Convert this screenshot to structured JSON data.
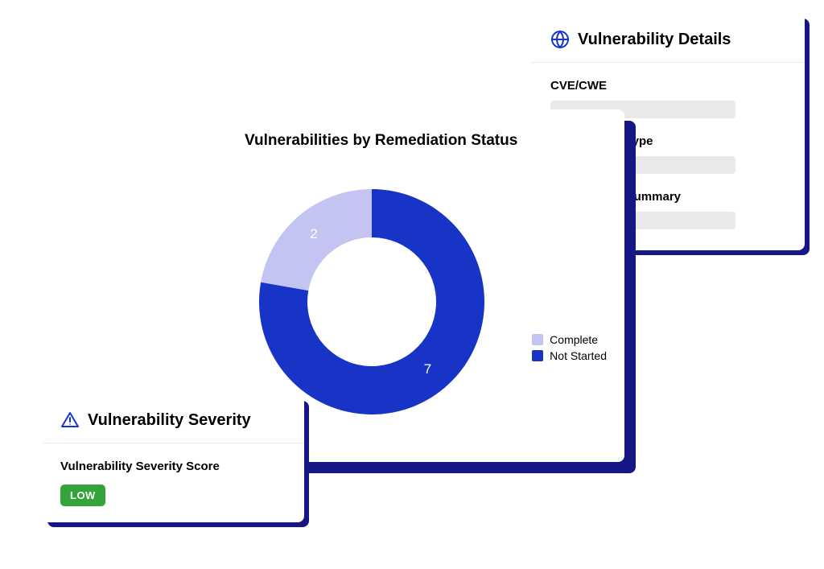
{
  "colors": {
    "primary": "#1834c7",
    "secondary": "#c4c4f2",
    "shadow": "#171686",
    "success": "#33a33a"
  },
  "details": {
    "title": "Vulnerability Details",
    "icon": "globe-icon",
    "fields": [
      {
        "label": "CVE/CWE"
      },
      {
        "label": "Vulnerability Type"
      },
      {
        "label": "Vulnerability Summary"
      }
    ]
  },
  "chart": {
    "title": "Vulnerabilities by Remediation Status",
    "legend": [
      {
        "label": "Complete",
        "color": "#c4c4f2"
      },
      {
        "label": "Not Started",
        "color": "#1834c7"
      }
    ]
  },
  "chart_data": {
    "type": "pie",
    "title": "Vulnerabilities by Remediation Status",
    "categories": [
      "Complete",
      "Not Started"
    ],
    "values": [
      2,
      7
    ],
    "series_colors": [
      "#c4c4f2",
      "#1834c7"
    ]
  },
  "severity": {
    "title": "Vulnerability Severity",
    "icon": "alert-icon",
    "score_label": "Vulnerability Severity Score",
    "badge": "LOW",
    "badge_color": "#33a33a"
  }
}
